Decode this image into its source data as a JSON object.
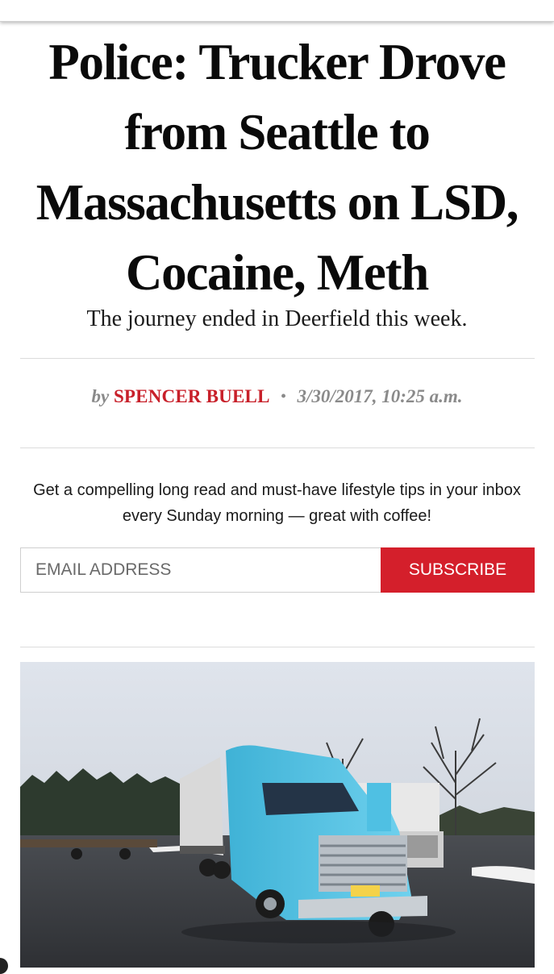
{
  "article": {
    "headline": "Police: Trucker Drove from Seattle to Massachusetts on LSD, Cocaine, Meth",
    "dek": "The journey ended in Deerfield this week.",
    "byline": {
      "by": "by",
      "author": "SPENCER BUELL",
      "separator": "•",
      "date": "3/30/2017, 10:25 a.m."
    }
  },
  "newsletter": {
    "promo": "Get a compelling long read and must-have lifestyle tips in your inbox every Sunday morning — great with coffee!",
    "email_placeholder": "EMAIL ADDRESS",
    "subscribe_label": "SUBSCRIBE"
  },
  "colors": {
    "accent": "#d41f2b",
    "author": "#c8202a",
    "truck_cab": "#55c3e3"
  },
  "icons": [
    "truck-photo"
  ]
}
